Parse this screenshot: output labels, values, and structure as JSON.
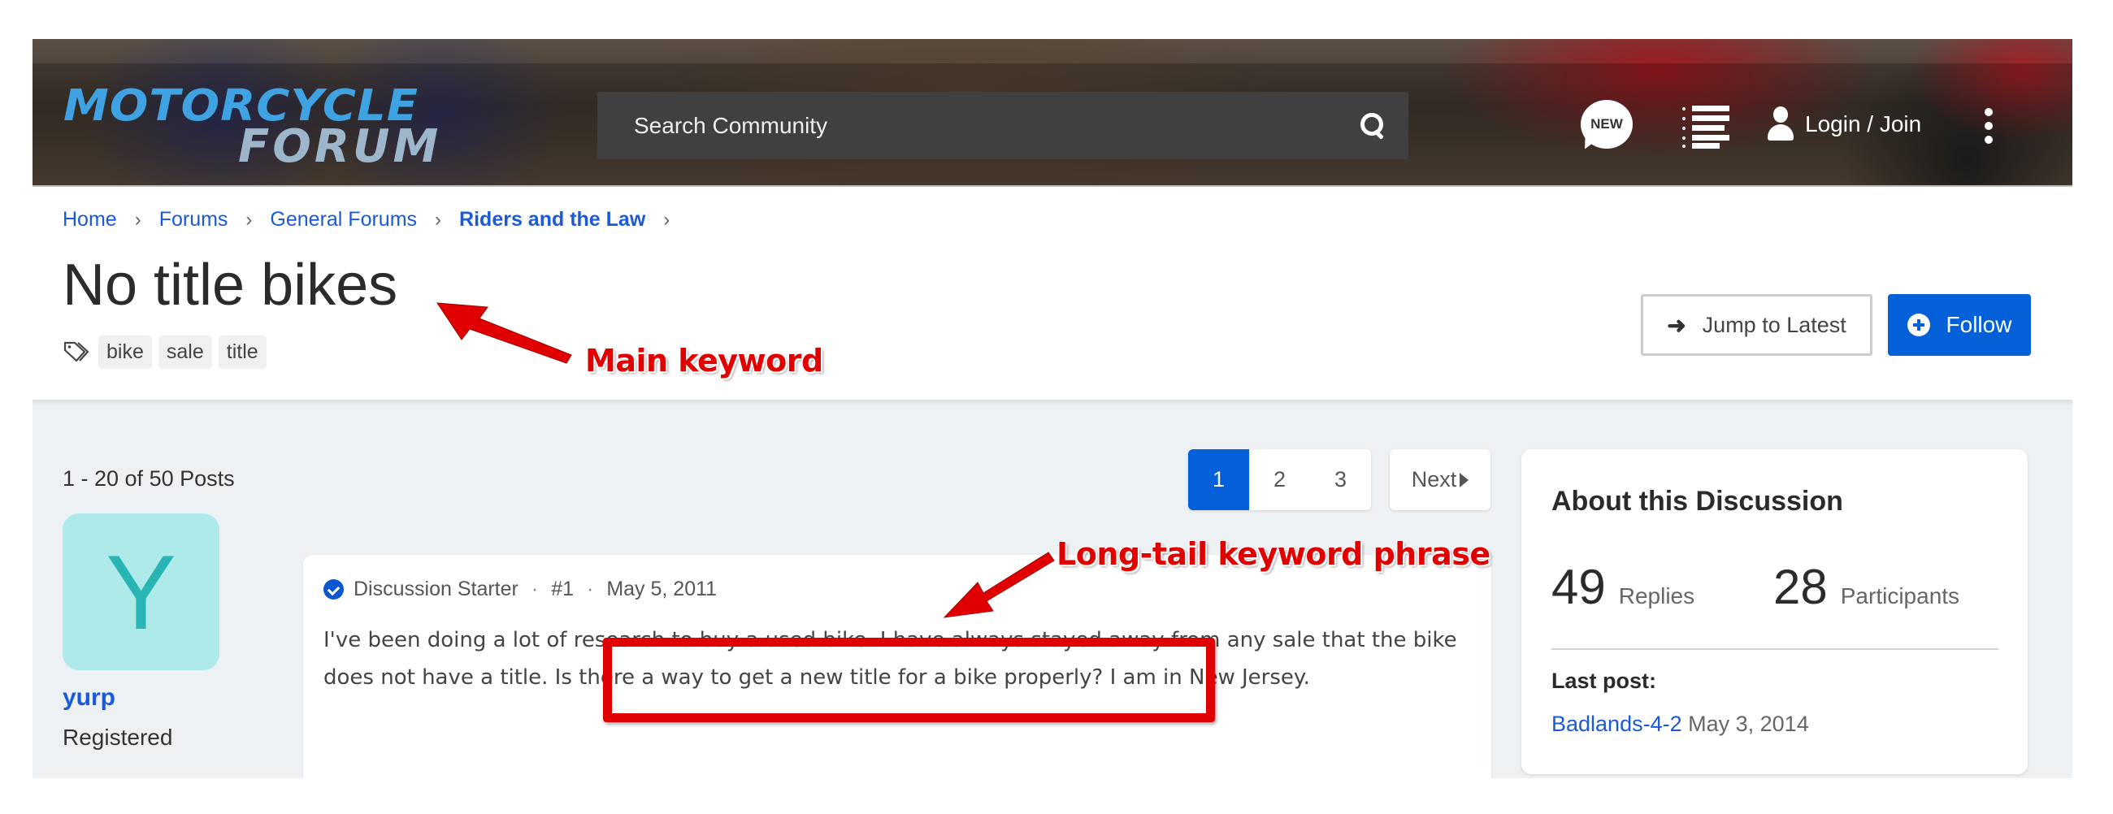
{
  "header": {
    "logo": {
      "line1": "Motorcycle",
      "line2": "Forum"
    },
    "search": {
      "placeholder": "Search Community",
      "icon": "search-icon"
    },
    "new_badge": "NEW",
    "login_label": "Login / Join"
  },
  "breadcrumb": [
    {
      "label": "Home"
    },
    {
      "label": "Forums"
    },
    {
      "label": "General Forums"
    },
    {
      "label": "Riders and the Law"
    }
  ],
  "thread": {
    "title": "No title bikes",
    "tags": [
      "bike",
      "sale",
      "title"
    ],
    "jump_label": "Jump to Latest",
    "follow_label": "Follow"
  },
  "posts": {
    "count_text": "1 - 20 of 50 Posts",
    "pagination": {
      "pages": [
        "1",
        "2",
        "3"
      ],
      "current": "1",
      "next_label": "Next"
    }
  },
  "post": {
    "author_initial": "Y",
    "author": "yurp",
    "author_role": "Registered",
    "badge": "Discussion Starter",
    "number": "#1",
    "date": "May 5, 2011",
    "body": "I've been doing a lot of research to buy a used bike. I have always stayed away from any sale that the bike does not have a title. Is there a way to get a new title for a bike properly? I am in New Jersey."
  },
  "about": {
    "heading": "About this Discussion",
    "replies_num": "49",
    "replies_label": "Replies",
    "participants_num": "28",
    "participants_label": "Participants",
    "last_post_label": "Last post:",
    "last_post_user": "Badlands-4-2",
    "last_post_date": "May 3, 2014"
  },
  "annotations": {
    "main_keyword": "Main keyword",
    "long_tail": "Long-tail keyword phrase",
    "color": "#e00000"
  },
  "colors": {
    "accent": "#0360d8",
    "link": "#1a5ad8",
    "avatar_bg": "#aeeaea",
    "avatar_fg": "#2ab5b5",
    "page_bg": "#eef1f4"
  }
}
